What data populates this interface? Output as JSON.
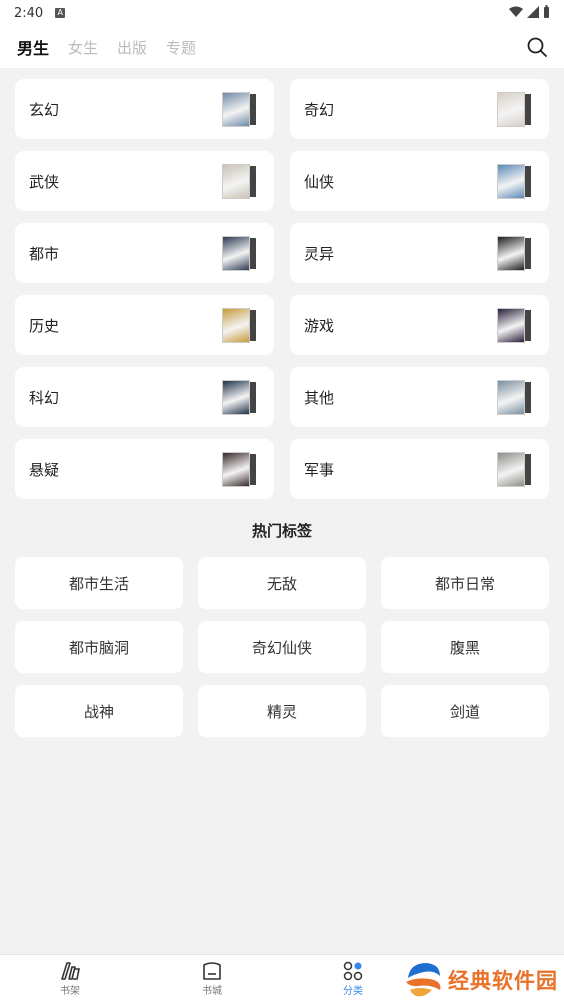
{
  "status_bar": {
    "time": "2:40"
  },
  "tabs": [
    {
      "label": "男生",
      "active": true
    },
    {
      "label": "女生",
      "active": false
    },
    {
      "label": "出版",
      "active": false
    },
    {
      "label": "专题",
      "active": false
    }
  ],
  "categories": [
    {
      "label": "玄幻",
      "cover_color": "#6f8aa6"
    },
    {
      "label": "奇幻",
      "cover_color": "#d8cfc6"
    },
    {
      "label": "武侠",
      "cover_color": "#c9c2b4"
    },
    {
      "label": "仙侠",
      "cover_color": "#5c88b8"
    },
    {
      "label": "都市",
      "cover_color": "#2d3b55"
    },
    {
      "label": "灵异",
      "cover_color": "#1e1e1e"
    },
    {
      "label": "历史",
      "cover_color": "#c89b3c"
    },
    {
      "label": "游戏",
      "cover_color": "#2a1f3a"
    },
    {
      "label": "科幻",
      "cover_color": "#1f3349"
    },
    {
      "label": "其他",
      "cover_color": "#7a8fa0"
    },
    {
      "label": "悬疑",
      "cover_color": "#3a2a2a"
    },
    {
      "label": "军事",
      "cover_color": "#8e8e88"
    }
  ],
  "hot_tags_title": "热门标签",
  "hot_tags": [
    "都市生活",
    "无敌",
    "都市日常",
    "都市脑洞",
    "奇幻仙侠",
    "腹黑",
    "战神",
    "精灵",
    "剑道"
  ],
  "bottom_nav": [
    {
      "label": "书架",
      "icon": "bookshelf-icon",
      "active": false
    },
    {
      "label": "书城",
      "icon": "bookstore-icon",
      "active": false
    },
    {
      "label": "分类",
      "icon": "category-icon",
      "active": true
    }
  ],
  "watermark": {
    "text": "经典软件园"
  },
  "colors": {
    "accent": "#3a86e8",
    "watermark": "#e9722a"
  }
}
